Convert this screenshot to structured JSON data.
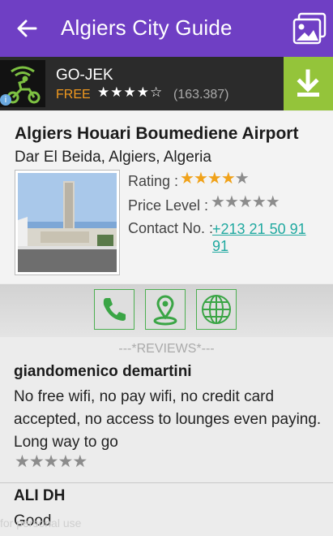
{
  "appbar": {
    "title": "Algiers City Guide",
    "back_icon": "arrow-left-icon",
    "gallery_icon": "image-gallery-icon"
  },
  "ad": {
    "name": "GO-JEK",
    "price": "FREE",
    "stars": "★★★★☆",
    "rating_count": "(163.387)",
    "download_icon": "download-icon",
    "info": "i",
    "accent": "#94c43a"
  },
  "place": {
    "name": "Algiers Houari Boumediene Airport",
    "address": "Dar El Beida, Algiers, Algeria",
    "rating_label": "Rating :",
    "rating": 4,
    "price_label": "Price Level :",
    "price_level": 0,
    "contact_label": "Contact No. :",
    "phone": "+213 21 50 91 91"
  },
  "actions": [
    {
      "icon": "phone-icon"
    },
    {
      "icon": "map-pin-icon"
    },
    {
      "icon": "globe-icon"
    }
  ],
  "reviews_title": "---*REVIEWS*---",
  "reviews": [
    {
      "author": "giandomenico demartini",
      "text": "No free wifi, no pay wifi, no credit card accepted, no access to lounges even paying. Long way to go",
      "rating": 0
    },
    {
      "author": "ALI DH",
      "text": "Good"
    }
  ],
  "watermark": "for personal use",
  "colors": {
    "appbar": "#6f3fc4",
    "star_on": "#f0a21a",
    "star_off": "#8c8c8c",
    "action_green": "#4caf50",
    "link": "#20a9a0"
  }
}
